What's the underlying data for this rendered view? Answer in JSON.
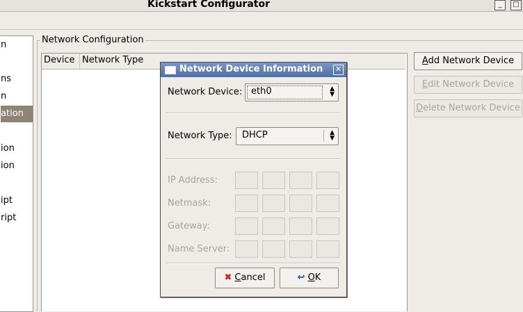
{
  "window": {
    "title": "Kickstart Configurator",
    "minimize": "_",
    "maximize": "□"
  },
  "sidebar": {
    "items": [
      {
        "label": "n"
      },
      {
        "label": "ns"
      },
      {
        "label": "n"
      },
      {
        "label": "ation",
        "selected": true
      },
      {
        "label": "ion"
      },
      {
        "label": "ion"
      },
      {
        "label": "ipt"
      },
      {
        "label": "ript"
      }
    ]
  },
  "main": {
    "section_label": "Network Configuration",
    "columns": [
      "Device",
      "Network Type"
    ],
    "buttons": {
      "add": {
        "prefix": "",
        "mnemonic": "A",
        "rest": "dd Network Device"
      },
      "edit": {
        "prefix": "",
        "mnemonic": "E",
        "rest": "dit Network Device"
      },
      "delete": {
        "prefix": "",
        "mnemonic": "D",
        "rest": "elete Network Device"
      }
    }
  },
  "dialog": {
    "title": "Network Device Information",
    "close": "✕",
    "device_label": "Network Device:",
    "device_value": "eth0",
    "type_label": "Network Type:",
    "type_value": "DHCP",
    "ip_label": "IP Address:",
    "netmask_label": "Netmask:",
    "gateway_label": "Gateway:",
    "nameserver_label": "Name Server:",
    "cancel": {
      "mnemonic": "C",
      "rest": "ancel",
      "icon": "✖"
    },
    "ok": {
      "mnemonic": "O",
      "rest": "K",
      "icon": "↩"
    }
  }
}
